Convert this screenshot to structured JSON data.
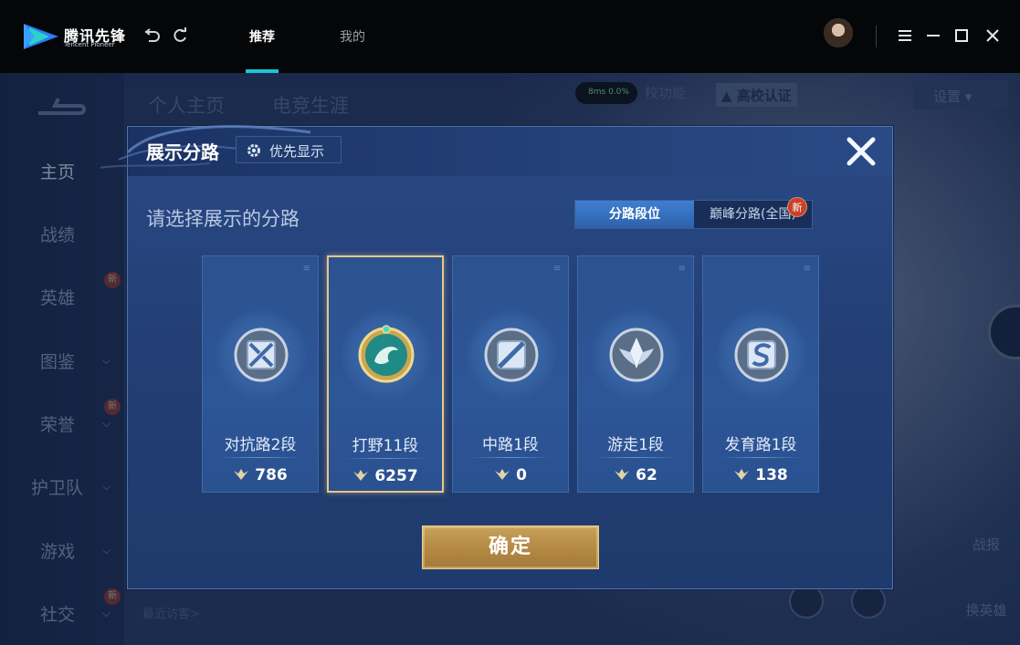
{
  "app": {
    "name_cn": "腾讯先锋",
    "name_en": "Tencent Pioneer",
    "tabs": [
      {
        "label": "推荐",
        "active": true
      },
      {
        "label": "我的",
        "active": false
      }
    ],
    "accent_color": "#1bc4d6"
  },
  "game": {
    "sidebar": [
      {
        "label": "主页",
        "active": true,
        "has_chevron": false,
        "badge": ""
      },
      {
        "label": "战绩",
        "active": false,
        "has_chevron": false,
        "badge": ""
      },
      {
        "label": "英雄",
        "active": false,
        "has_chevron": false,
        "badge": "新"
      },
      {
        "label": "图鉴",
        "active": false,
        "has_chevron": true,
        "badge": ""
      },
      {
        "label": "荣誉",
        "active": false,
        "has_chevron": true,
        "badge": "新"
      },
      {
        "label": "护卫队",
        "active": false,
        "has_chevron": true,
        "badge": ""
      },
      {
        "label": "游戏",
        "active": false,
        "has_chevron": true,
        "badge": ""
      },
      {
        "label": "社交",
        "active": false,
        "has_chevron": true,
        "badge": "新"
      }
    ],
    "top_tabs": [
      "个人主页",
      "电竞生涯"
    ],
    "ping": "8ms",
    "loss": "0.0%",
    "chip_campus_func": "校功能",
    "chip_campus_cert": "高校认证",
    "dropdown_label": "设置",
    "recent_visitors": "最近访客>",
    "side_btn_1": "战报",
    "side_btn_2": "换英雄"
  },
  "modal": {
    "title": "展示分路",
    "priority_label": "优先显示",
    "prompt": "请选择展示的分路",
    "segments": [
      {
        "label": "分路段位",
        "active": true
      },
      {
        "label": "巅峰分路(全国)",
        "active": false
      }
    ],
    "new_badge": "新",
    "cards": [
      {
        "name": "对抗路2段",
        "score": "786",
        "selected": false,
        "emblem": "clash-lane-emblem-icon"
      },
      {
        "name": "打野11段",
        "score": "6257",
        "selected": true,
        "emblem": "jungle-dragon-emblem-icon"
      },
      {
        "name": "中路1段",
        "score": "0",
        "selected": false,
        "emblem": "mid-lane-emblem-icon"
      },
      {
        "name": "游走1段",
        "score": "62",
        "selected": false,
        "emblem": "roam-emblem-icon"
      },
      {
        "name": "发育路1段",
        "score": "138",
        "selected": false,
        "emblem": "farm-lane-emblem-icon"
      }
    ],
    "confirm_label": "确定",
    "colors": {
      "selected_border": "#e6c788",
      "confirm_gold": "#b48a45"
    }
  }
}
